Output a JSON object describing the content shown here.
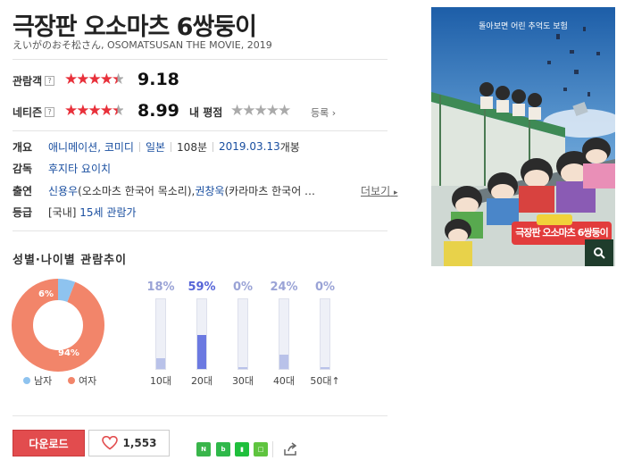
{
  "movie": {
    "title": "극장판 오소마츠 6쌍둥이",
    "subtitle": "えいがのおそ松さん, OSOMATSUSAN THE MOVIE, 2019"
  },
  "ratings": {
    "audience": {
      "label": "관람객",
      "help": "?",
      "score": "9.18",
      "stars": 4.6
    },
    "netizen": {
      "label": "네티즌",
      "help": "?",
      "score": "8.99",
      "stars": 4.5
    },
    "my_rating": {
      "label": "내 평점",
      "link": "등록",
      "stars": 0
    }
  },
  "info": {
    "overview": {
      "key": "개요",
      "genre": "애니메이션, 코미디",
      "country": "일본",
      "runtime": "108분",
      "release_date": "2019.03.13",
      "release_suffix": "개봉"
    },
    "director": {
      "key": "감독",
      "value": "후지타 요이치"
    },
    "cast": {
      "key": "출연",
      "actor1": "신용우",
      "role1": "(오소마츠 한국어 목소리), ",
      "actor2": "권창욱",
      "role2": "(카라마츠 한국어 …",
      "more": "더보기"
    },
    "grade": {
      "key": "등급",
      "country": "[국내]",
      "value": "15세 관람가"
    }
  },
  "poster": {
    "tagline": "돌아보면 어린 추억도 보험",
    "logo_text": "극장판 오소마츠 6쌍둥이"
  },
  "stats": {
    "title": "성별·나이별 관람추이",
    "gender": {
      "male_pct": 6,
      "female_pct": 94,
      "male_label": "6%",
      "female_label": "94%",
      "male_legend": "남자",
      "female_legend": "여자",
      "male_color": "#8ec3ef",
      "female_color": "#f2856a"
    },
    "age": [
      {
        "label": "10대",
        "pct_label": "18%",
        "value": 18,
        "highlight": false
      },
      {
        "label": "20대",
        "pct_label": "59%",
        "value": 59,
        "highlight": true
      },
      {
        "label": "30대",
        "pct_label": "0%",
        "value": 0,
        "highlight": false
      },
      {
        "label": "40대",
        "pct_label": "24%",
        "value": 24,
        "highlight": false
      },
      {
        "label": "50대↑",
        "pct_label": "0%",
        "value": 0,
        "highlight": false
      }
    ]
  },
  "actions": {
    "download": "다운로드",
    "like_count": "1,553",
    "share_colors": [
      "#39b54a",
      "#2fb84a",
      "#1fbf3c",
      "#5fc43f"
    ]
  }
}
